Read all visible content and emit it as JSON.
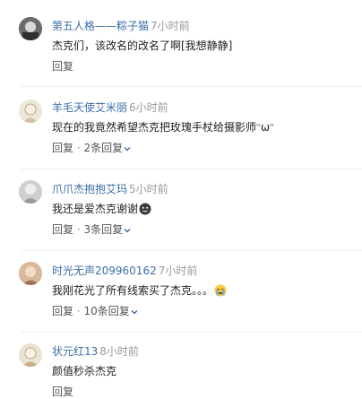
{
  "comments": [
    {
      "username": "第五人格——粽子猫",
      "time": "7小时前",
      "text": "杰克们，该改名的改名了啊[我想静静]",
      "reply_label": "回复",
      "replies_label": ""
    },
    {
      "username": "羊毛天使艾米丽",
      "time": "6小时前",
      "text": "现在的我竟然希望杰克把玫瑰手杖给摄影师",
      "text_suffix": "ᵔωᵔ",
      "reply_label": "回复",
      "replies_label": "2条回复"
    },
    {
      "username": "爪爪杰抱抱艾玛",
      "time": "5小时前",
      "text": "我还是爱杰克谢谢",
      "reply_label": "回复",
      "replies_label": "3条回复",
      "emoji": "smirk-face-emoji"
    },
    {
      "username": "时光无声209960162",
      "time": "7小时前",
      "text": "我刚花光了所有线索买了杰克。。。",
      "reply_label": "回复",
      "replies_label": "10条回复",
      "emoji": "crying-face-emoji"
    },
    {
      "username": "状元红13",
      "time": "8小时前",
      "text": "颜值秒杀杰克",
      "reply_label": "回复",
      "replies_label": ""
    }
  ],
  "separator": "·"
}
